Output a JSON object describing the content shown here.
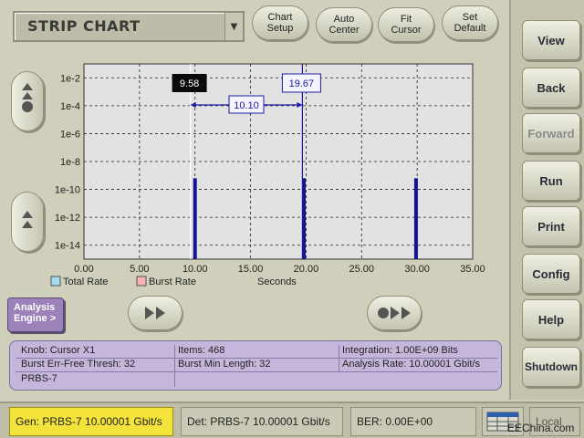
{
  "header": {
    "title": "STRIP CHART",
    "buttons": [
      {
        "id": "chart-setup",
        "label": "Chart\nSetup"
      },
      {
        "id": "auto-center",
        "label": "Auto\nCenter"
      },
      {
        "id": "fit-cursor",
        "label": "Fit\nCursor"
      },
      {
        "id": "set-default",
        "label": "Set\nDefault"
      }
    ]
  },
  "sidebar": {
    "items": [
      {
        "id": "view",
        "label": "View",
        "disabled": false
      },
      {
        "id": "back",
        "label": "Back",
        "disabled": false
      },
      {
        "id": "forward",
        "label": "Forward",
        "disabled": true
      },
      {
        "id": "run",
        "label": "Run",
        "disabled": false
      },
      {
        "id": "print",
        "label": "Print",
        "disabled": false
      },
      {
        "id": "config",
        "label": "Config",
        "disabled": false
      },
      {
        "id": "help",
        "label": "Help",
        "disabled": false
      },
      {
        "id": "shutdown",
        "label": "Shutdown",
        "disabled": false
      }
    ]
  },
  "chart_data": {
    "type": "bar",
    "title": "",
    "xlabel": "Seconds",
    "ylabel": "",
    "xlim": [
      0,
      35
    ],
    "y_scale": "log",
    "ylim_exponent": [
      -15,
      -1
    ],
    "x_ticks": [
      "0.00",
      "5.00",
      "10.00",
      "15.00",
      "20.00",
      "25.00",
      "30.00",
      "35.00"
    ],
    "y_ticks": [
      "1e-2",
      "1e-4",
      "1e-6",
      "1e-8",
      "1e-10",
      "1e-12",
      "1e-14"
    ],
    "grid": true,
    "legend": [
      "Total Rate",
      "Burst Rate"
    ],
    "legend_colors": [
      "#a8ddf0",
      "#f5b3b3"
    ],
    "series": [
      {
        "name": "Total Rate",
        "x": [
          10.0,
          19.8,
          29.9
        ],
        "y_exponent": [
          -9.2,
          -9.2,
          -9.2
        ],
        "color": "#14148c"
      }
    ],
    "cursors": [
      {
        "label": "9.58",
        "x": 9.58,
        "style": "dark",
        "color": "#ffffff"
      },
      {
        "label": "19.67",
        "x": 19.67,
        "style": "light",
        "color": "#1c1ca0"
      }
    ],
    "delta_label": "10.10"
  },
  "controls": {
    "analysis_engine": "Analysis\nEngine >"
  },
  "info": {
    "knob": "Knob:  Cursor X1",
    "items": "Items: 468",
    "integration": "Integration: 1.00E+09 Bits",
    "burst_thresh": "Burst Err-Free Thresh: 32",
    "burst_min_length": "Burst Min Length: 32",
    "analysis_rate": "Analysis Rate: 10.00001 Gbit/s",
    "pattern": "PRBS-7"
  },
  "status": {
    "gen": "Gen: PRBS-7 10.00001 Gbit/s",
    "det": "Det: PRBS-7 10.00001 Gbit/s",
    "ber": "BER: 0.00E+00",
    "local": "Local",
    "watermark": "EEChina.com"
  }
}
